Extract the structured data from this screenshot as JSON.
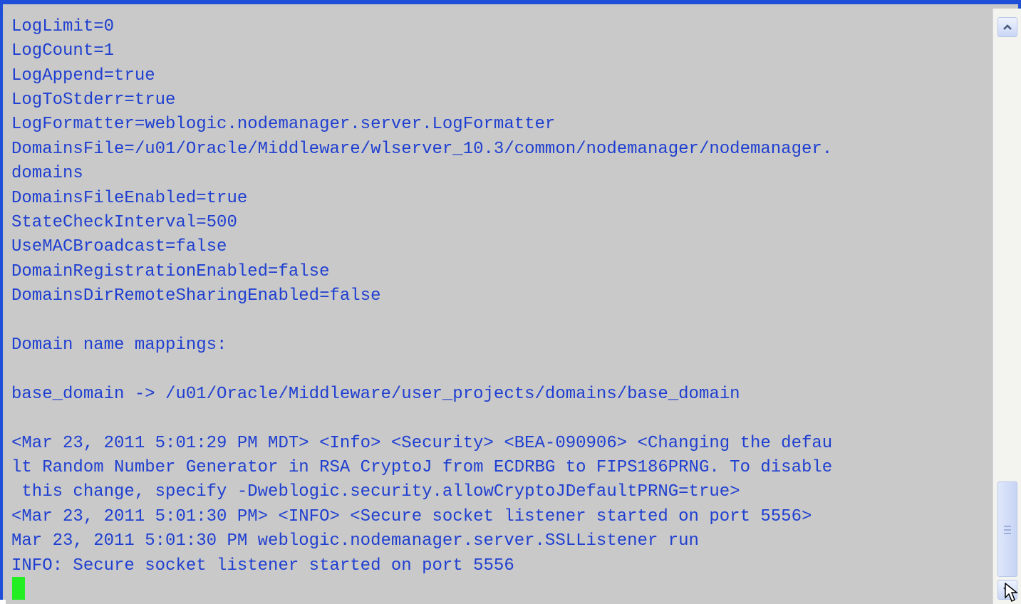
{
  "terminal": {
    "lines": [
      "LogLimit=0",
      "LogCount=1",
      "LogAppend=true",
      "LogToStderr=true",
      "LogFormatter=weblogic.nodemanager.server.LogFormatter",
      "DomainsFile=/u01/Oracle/Middleware/wlserver_10.3/common/nodemanager/nodemanager.",
      "domains",
      "DomainsFileEnabled=true",
      "StateCheckInterval=500",
      "UseMACBroadcast=false",
      "DomainRegistrationEnabled=false",
      "DomainsDirRemoteSharingEnabled=false",
      "",
      "Domain name mappings:",
      "",
      "base_domain -> /u01/Oracle/Middleware/user_projects/domains/base_domain",
      "",
      "<Mar 23, 2011 5:01:29 PM MDT> <Info> <Security> <BEA-090906> <Changing the defau",
      "lt Random Number Generator in RSA CryptoJ from ECDRBG to FIPS186PRNG. To disable",
      " this change, specify -Dweblogic.security.allowCryptoJDefaultPRNG=true>",
      "<Mar 23, 2011 5:01:30 PM> <INFO> <Secure socket listener started on port 5556>",
      "Mar 23, 2011 5:01:30 PM weblogic.nodemanager.server.SSLListener run",
      "INFO: Secure socket listener started on port 5556"
    ],
    "text_color": "#1f3fd0",
    "background_color": "#c9c9c9",
    "cursor_color": "#22ee22"
  },
  "scrollbar": {
    "up_icon": "chevron-up-icon",
    "down_icon": "chevron-down-icon",
    "position": "bottom"
  },
  "window": {
    "border_color": "#1f4fd8"
  }
}
